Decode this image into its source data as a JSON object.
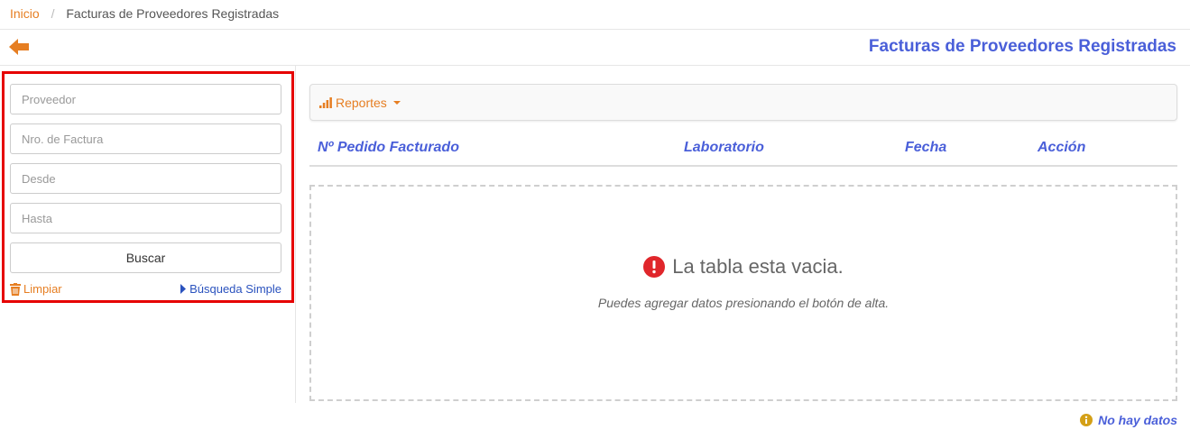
{
  "breadcrumb": {
    "home": "Inicio",
    "separator": "/",
    "current": "Facturas de Proveedores Registradas"
  },
  "header": {
    "title": "Facturas de Proveedores Registradas",
    "back_icon": "arrow-left-icon"
  },
  "search": {
    "proveedor_placeholder": "Proveedor",
    "factura_placeholder": "Nro. de Factura",
    "desde_placeholder": "Desde",
    "hasta_placeholder": "Hasta",
    "button_label": "Buscar",
    "clear_label": "Limpiar",
    "simple_label": "Búsqueda Simple"
  },
  "toolbar": {
    "reportes_label": "Reportes"
  },
  "table": {
    "columns": [
      "Nº Pedido Facturado",
      "Laboratorio",
      "Fecha",
      "Acción"
    ],
    "empty_title": "La tabla esta vacia.",
    "empty_subtitle": "Puedes agregar datos presionando el botón de alta."
  },
  "footer": {
    "status": "No hay datos"
  },
  "colors": {
    "accent_orange": "#e67e22",
    "title_blue": "#4a5fd9",
    "highlight_red": "#e60000",
    "error_red": "#e0262b",
    "info_yellow": "#d4a017"
  }
}
